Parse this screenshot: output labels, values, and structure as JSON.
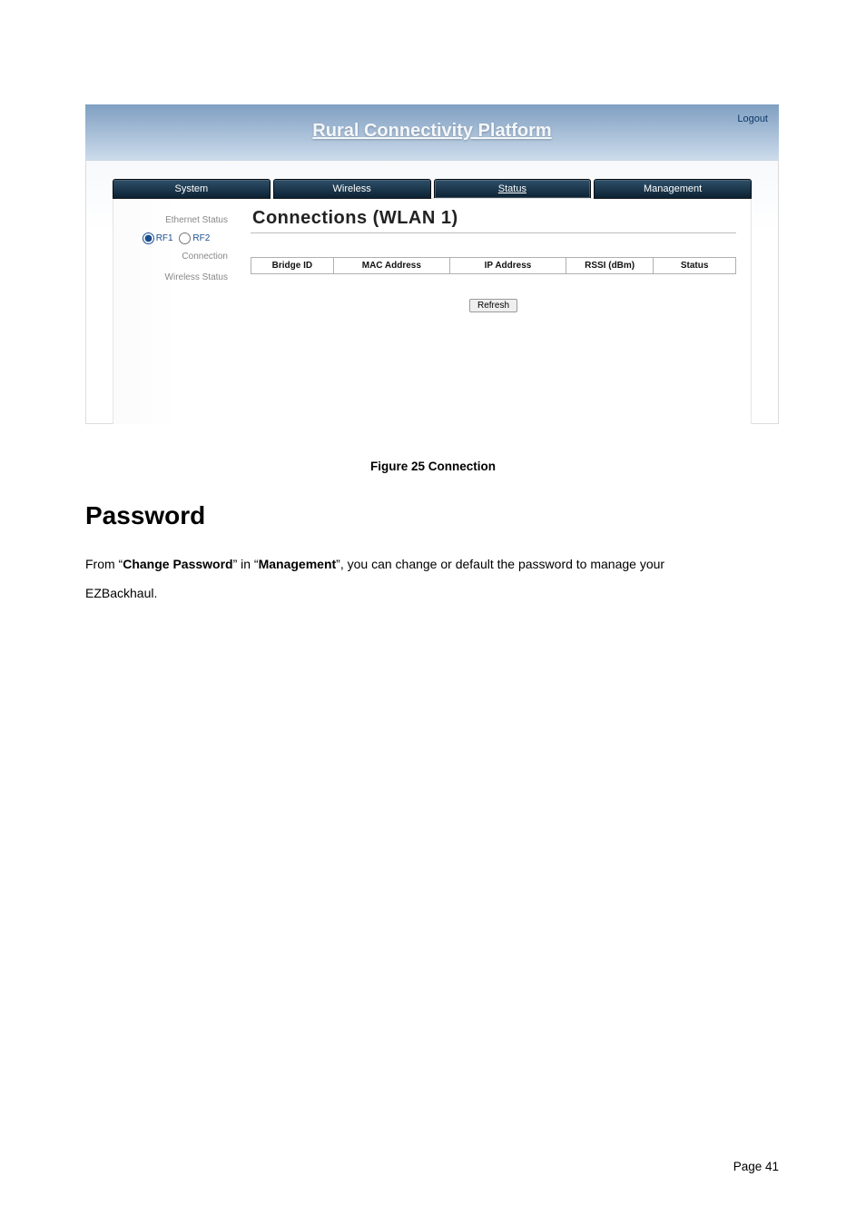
{
  "brand": {
    "title": "Rural Connectivity Platform",
    "logout": "Logout"
  },
  "tabs": [
    {
      "label": "System"
    },
    {
      "label": "Wireless"
    },
    {
      "label": "Status"
    },
    {
      "label": "Management"
    }
  ],
  "sidebar": {
    "items": [
      {
        "label": "Ethernet Status"
      },
      {
        "label": "Connection"
      },
      {
        "label": "Wireless Status"
      }
    ],
    "rf1": "RF1",
    "rf2": "RF2"
  },
  "main": {
    "heading": "Connections  (WLAN 1)",
    "columns": [
      "Bridge ID",
      "MAC Address",
      "IP Address",
      "RSSI (dBm)",
      "Status"
    ],
    "refresh": "Refresh"
  },
  "doc": {
    "caption": "Figure 25 Connection",
    "heading": "Password",
    "para_from": "From “",
    "para_chgpwd": "Change Password",
    "para_in": "” in “",
    "para_mgmt": "Management",
    "para_rest": "”, you can change or default the password to manage your",
    "para_line2": "EZBackhaul.",
    "footer": "Page 41"
  }
}
